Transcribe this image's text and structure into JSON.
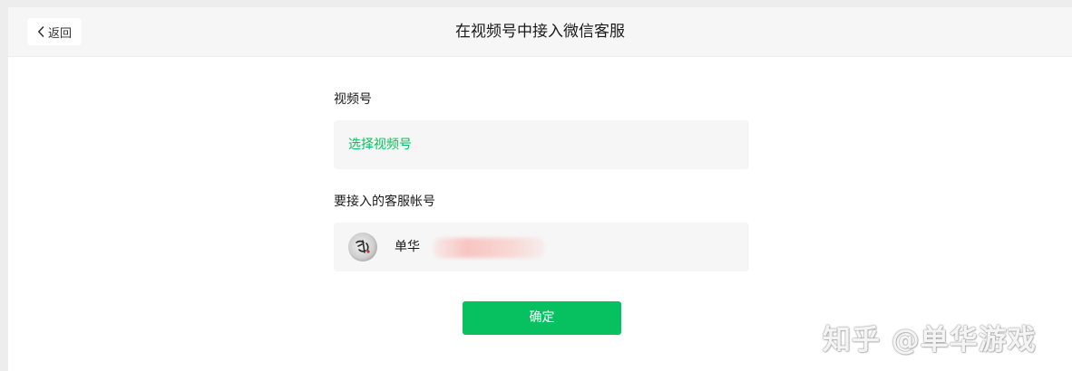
{
  "header": {
    "back_label": "返回",
    "title": "在视频号中接入微信客服"
  },
  "form": {
    "channel_label": "视频号",
    "channel_select_label": "选择视频号",
    "account_label": "要接入的客服帐号",
    "account_name": "单华"
  },
  "actions": {
    "confirm_label": "确定"
  },
  "watermark": {
    "text": "知乎 @单华游戏"
  },
  "colors": {
    "accent": "#07c160",
    "panel_bg": "#f6f6f6",
    "page_bg": "#ffffff"
  },
  "icons": {
    "back": "chevron-left-icon",
    "avatar": "account-avatar"
  }
}
